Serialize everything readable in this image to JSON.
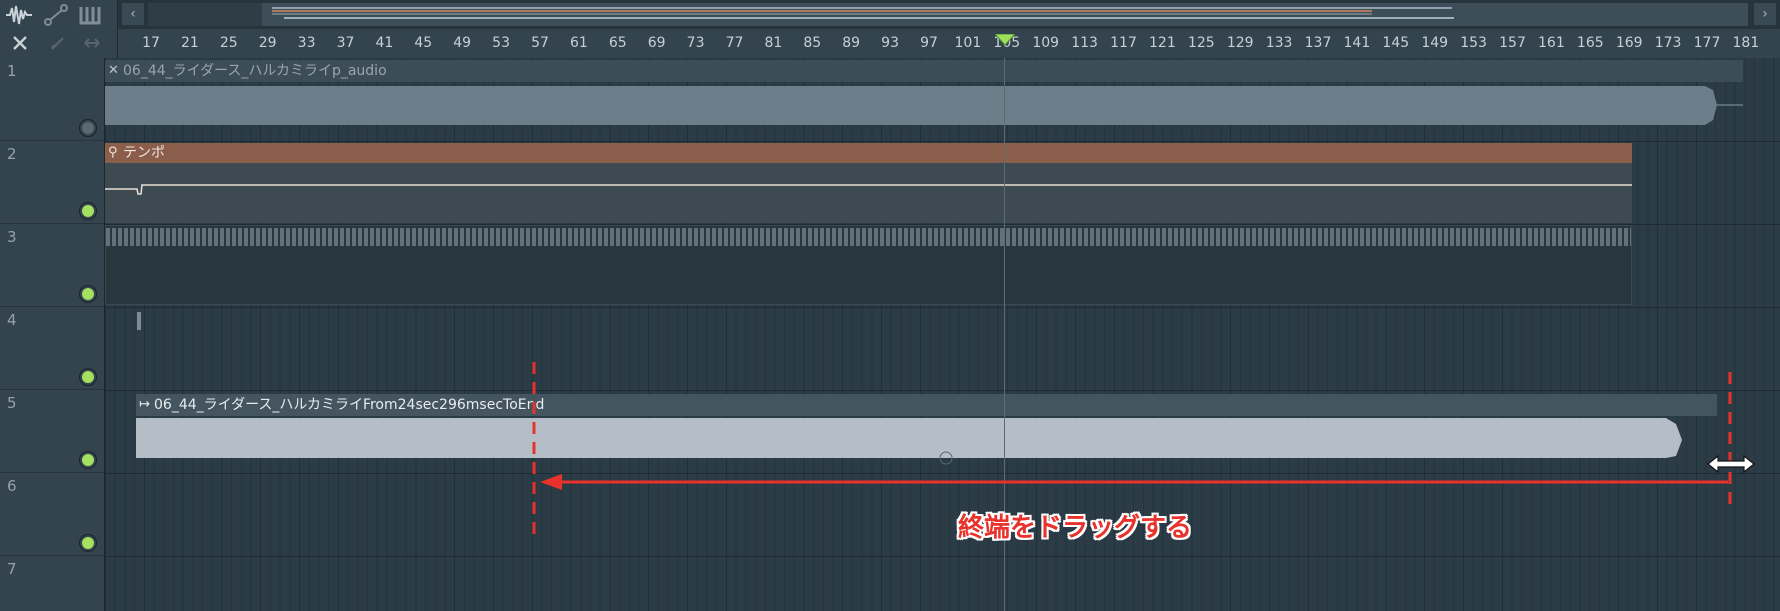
{
  "ruler": {
    "ticks": [
      "17",
      "21",
      "25",
      "29",
      "33",
      "37",
      "41",
      "45",
      "49",
      "53",
      "57",
      "61",
      "65",
      "69",
      "73",
      "77",
      "81",
      "85",
      "89",
      "93",
      "97",
      "101",
      "105",
      "109",
      "113",
      "117",
      "121",
      "125",
      "129",
      "133",
      "137",
      "141",
      "145",
      "149",
      "153",
      "157",
      "161",
      "165",
      "169",
      "173",
      "177",
      "181"
    ]
  },
  "tracks": [
    {
      "number": "1",
      "mute_led": "off"
    },
    {
      "number": "2",
      "mute_led": "on"
    },
    {
      "number": "3",
      "mute_led": "on"
    },
    {
      "number": "4",
      "mute_led": "on"
    },
    {
      "number": "5",
      "mute_led": "on"
    },
    {
      "number": "6",
      "mute_led": "on"
    },
    {
      "number": "7",
      "mute_led": "on"
    }
  ],
  "clips": {
    "audio1": {
      "name": "06_44_ライダース_ハルカミライp_audio",
      "icon": "close-icon"
    },
    "tempo": {
      "name": "テンポ",
      "icon": "automation-icon"
    },
    "audio5": {
      "name": "06_44_ライダース_ハルカミライFrom24sec296msecToEnd",
      "icon": "slice-arrow-icon"
    }
  },
  "annotation": {
    "text": "終端をドラッグする",
    "color": "#e8322b"
  },
  "colors": {
    "audio_clip_1": "#6d7e8a",
    "audio_clip_5": "#b5bec6",
    "tempo_header": "#8a5e4b",
    "led_on": "#a6e060"
  }
}
